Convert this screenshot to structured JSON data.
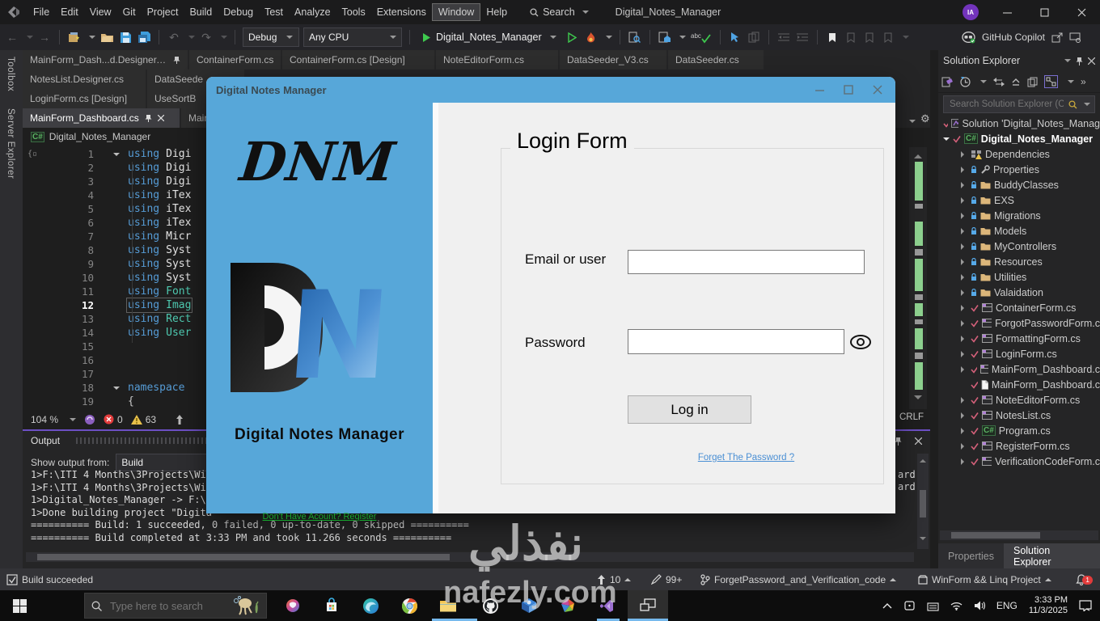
{
  "icons": {
    "cs": "C#",
    "back": "←",
    "forward": "→",
    "undo": "↶",
    "redo": "↷",
    "gear": "⚙",
    "overflow": "»",
    "abc": "abc",
    "infinity": "∞"
  },
  "titlebar": {
    "menus": [
      "File",
      "Edit",
      "View",
      "Git",
      "Project",
      "Build",
      "Debug",
      "Test",
      "Analyze",
      "Tools",
      "Extensions",
      "Window",
      "Help"
    ],
    "search_label": "Search",
    "app_title": "Digital_Notes_Manager",
    "avatar": "IA"
  },
  "toolbar": {
    "config": "Debug",
    "platform": "Any CPU",
    "start_target": "Digital_Notes_Manager",
    "copilot_label": "GitHub Copilot"
  },
  "tab_rows": {
    "row1": [
      "MainForm_Dash...d.Designer.cs",
      "ContainerForm.cs",
      "ContainerForm.cs [Design]",
      "NoteEditorForm.cs",
      "DataSeeder_V3.cs",
      "DataSeeder.cs"
    ],
    "row2": [
      "NotesList.Designer.cs",
      "DataSeede"
    ],
    "row3": [
      "LoginForm.cs [Design]",
      "UseSortB"
    ],
    "row4": [
      "MainForm_Dashboard.cs",
      "MainF"
    ]
  },
  "side_strip": {
    "toolbox": "Toolbox",
    "server_explorer": "Server Explorer"
  },
  "editor": {
    "breadcrumb": "Digital_Notes_Manager",
    "lines": [
      {
        "n": "1",
        "kw": "using",
        "id": "Digi"
      },
      {
        "n": "2",
        "kw": "using",
        "id": "Digi"
      },
      {
        "n": "3",
        "kw": "using",
        "id": "Digi"
      },
      {
        "n": "4",
        "kw": "using",
        "id": "iTex"
      },
      {
        "n": "5",
        "kw": "using",
        "id": "iTex"
      },
      {
        "n": "6",
        "kw": "using",
        "id": "iTex"
      },
      {
        "n": "7",
        "kw": "using",
        "id": "Micr"
      },
      {
        "n": "8",
        "kw": "using",
        "id": "Syst"
      },
      {
        "n": "9",
        "kw": "using",
        "id": "Syst"
      },
      {
        "n": "10",
        "kw": "using",
        "id": "Syst"
      },
      {
        "n": "11",
        "kw": "using",
        "id": "Font"
      },
      {
        "n": "12",
        "kw": "using",
        "id": "Imag"
      },
      {
        "n": "13",
        "kw": "using",
        "id": "Rect"
      },
      {
        "n": "14",
        "kw": "using",
        "id": "User"
      },
      {
        "n": "15",
        "kw": "",
        "id": ""
      },
      {
        "n": "16",
        "kw": "",
        "id": ""
      },
      {
        "n": "17",
        "kw": "",
        "id": ""
      },
      {
        "n": "18",
        "kw": "namespace",
        "id": ""
      },
      {
        "n": "19",
        "kw": "",
        "id": "{"
      }
    ],
    "zoom": "104 %",
    "errors": "0",
    "warnings": "63",
    "eol": "CRLF"
  },
  "output": {
    "title": "Output",
    "source_label": "Show output from:",
    "source_value": "Build",
    "lines": [
      "1>F:\\ITI 4 Months\\3Projects\\Wi",
      "1>F:\\ITI 4 Months\\3Projects\\Wi",
      "1>Digital_Notes_Manager -> F:\\",
      "1>Done building project \"Digita",
      "========== Build: 1 succeeded, 0 failed, 0 up-to-date, 0 skipped ==========",
      "========== Build completed at 3:33 PM and took 11.266 seconds =========="
    ],
    "right_fragments": [
      "ard.",
      "ard."
    ]
  },
  "solution_explorer": {
    "title": "Solution Explorer",
    "search_placeholder": "Search Solution Explorer (Ct",
    "tree": [
      {
        "label": "Solution 'Digital_Notes_Manag"
      },
      {
        "label": "Digital_Notes_Manager"
      },
      {
        "label": "Dependencies"
      },
      {
        "label": "Properties"
      },
      {
        "label": "BuddyClasses"
      },
      {
        "label": "EXS"
      },
      {
        "label": "Migrations"
      },
      {
        "label": "Models"
      },
      {
        "label": "MyControllers"
      },
      {
        "label": "Resources"
      },
      {
        "label": "Utilities"
      },
      {
        "label": "Valaidation"
      },
      {
        "label": "ContainerForm.cs"
      },
      {
        "label": "ForgotPasswordForm.c"
      },
      {
        "label": "FormattingForm.cs"
      },
      {
        "label": "LoginForm.cs"
      },
      {
        "label": "MainForm_Dashboard.c"
      },
      {
        "label": "MainForm_Dashboard.c"
      },
      {
        "label": "NoteEditorForm.cs"
      },
      {
        "label": "NotesList.cs"
      },
      {
        "label": "Program.cs"
      },
      {
        "label": "RegisterForm.cs"
      },
      {
        "label": "VerificationCodeForm.c"
      }
    ],
    "bottom_tabs": [
      "Properties",
      "Solution Explorer"
    ]
  },
  "status_bar": {
    "message": "Build succeeded",
    "sync_count": "10",
    "edits_count": "99+",
    "branch": "ForgetPassword_and_Verification_code",
    "project": "WinForm && Linq Project",
    "notifications": "1"
  },
  "dialog": {
    "title": "Digital Notes Manager",
    "brand_acronym": "DNM",
    "brand_name": "Digital Notes Manager",
    "register_link": "Don't Have Acount? Register",
    "group_title": "Login Form",
    "email_label": "Email or user",
    "password_label": "Password",
    "login_button": "Log in",
    "forgot_link": "Forget The Password ?"
  },
  "taskbar": {
    "search_placeholder": "Type here to search",
    "language": "ENG",
    "time": "3:33 PM",
    "date": "11/3/2025"
  },
  "watermark": {
    "arabic": "نفذلي",
    "domain": "nafezly.com"
  }
}
